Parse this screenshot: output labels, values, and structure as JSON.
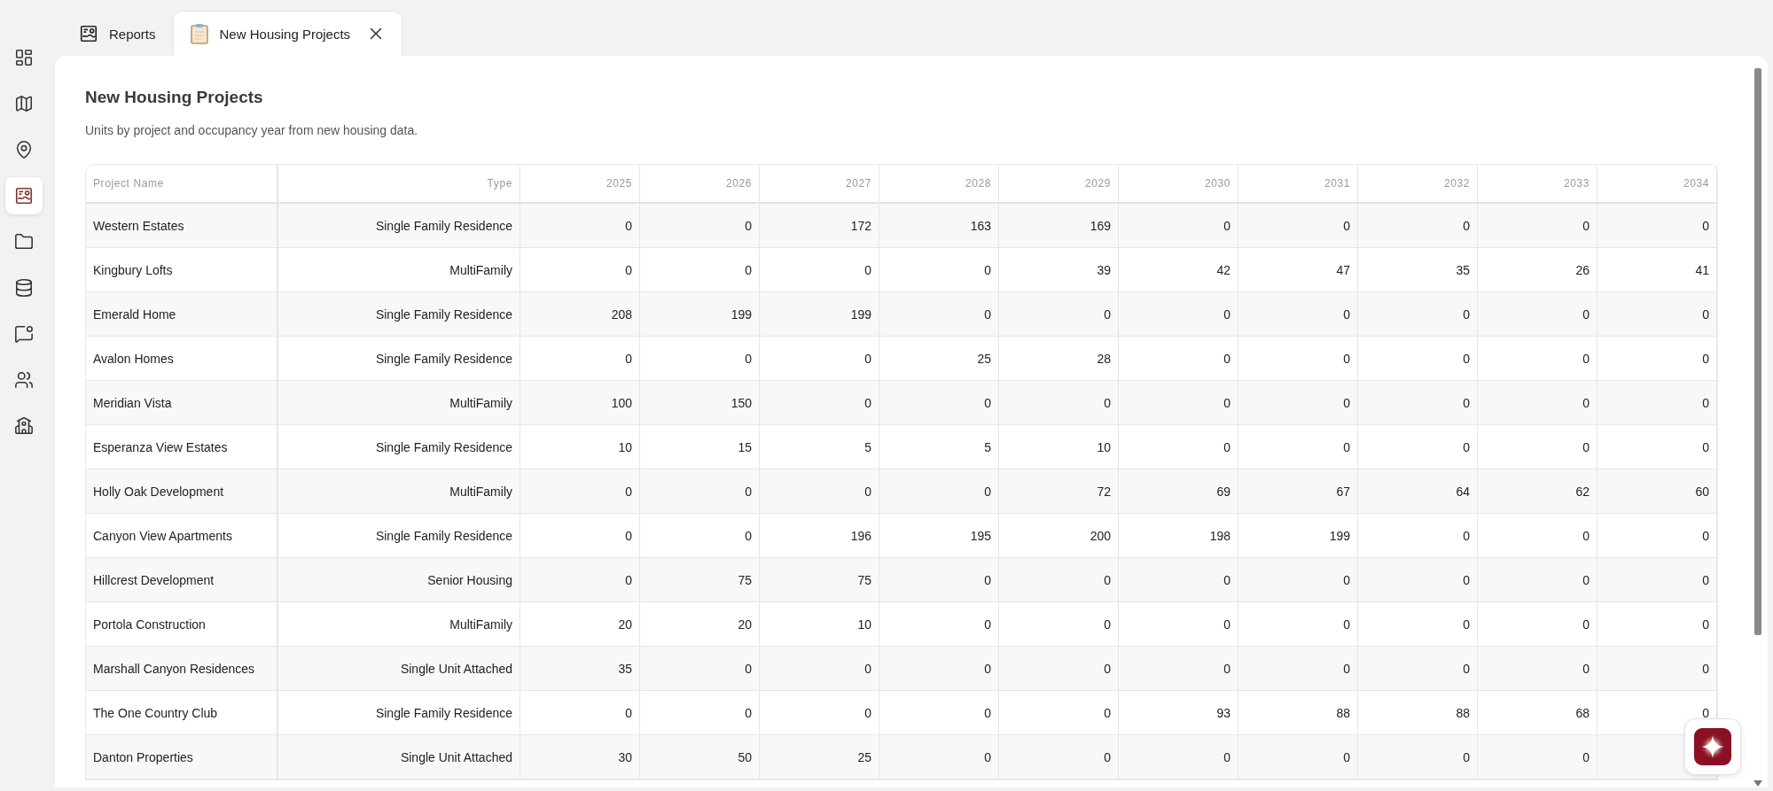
{
  "sidebar": {
    "items": [
      {
        "kind": "dashboard",
        "selected": false
      },
      {
        "kind": "map",
        "selected": false
      },
      {
        "kind": "pin",
        "selected": false
      },
      {
        "kind": "report",
        "selected": true
      },
      {
        "kind": "folder",
        "selected": false
      },
      {
        "kind": "database",
        "selected": false
      },
      {
        "kind": "chat",
        "selected": false
      },
      {
        "kind": "users",
        "selected": false
      },
      {
        "kind": "building",
        "selected": false
      }
    ]
  },
  "tabs": [
    {
      "label": "Reports",
      "kind": "report",
      "selected": false,
      "closable": false
    },
    {
      "label": "New Housing Projects",
      "kind": "clipboard",
      "selected": true,
      "closable": true
    }
  ],
  "report": {
    "title": "New Housing Projects",
    "subtitle": "Units by project and occupancy year from new housing data."
  },
  "table": {
    "columns": [
      "Project Name",
      "Type",
      "2025",
      "2026",
      "2027",
      "2028",
      "2029",
      "2030",
      "2031",
      "2032",
      "2033",
      "2034"
    ],
    "rows": [
      [
        "Western Estates",
        "Single Family Residence",
        "0",
        "0",
        "172",
        "163",
        "169",
        "0",
        "0",
        "0",
        "0",
        "0"
      ],
      [
        "Kingbury Lofts",
        "MultiFamily",
        "0",
        "0",
        "0",
        "0",
        "39",
        "42",
        "47",
        "35",
        "26",
        "41"
      ],
      [
        "Emerald Home",
        "Single Family Residence",
        "208",
        "199",
        "199",
        "0",
        "0",
        "0",
        "0",
        "0",
        "0",
        "0"
      ],
      [
        "Avalon Homes",
        "Single Family Residence",
        "0",
        "0",
        "0",
        "25",
        "28",
        "0",
        "0",
        "0",
        "0",
        "0"
      ],
      [
        "Meridian Vista",
        "MultiFamily",
        "100",
        "150",
        "0",
        "0",
        "0",
        "0",
        "0",
        "0",
        "0",
        "0"
      ],
      [
        "Esperanza View Estates",
        "Single Family Residence",
        "10",
        "15",
        "5",
        "5",
        "10",
        "0",
        "0",
        "0",
        "0",
        "0"
      ],
      [
        "Holly Oak Development",
        "MultiFamily",
        "0",
        "0",
        "0",
        "0",
        "72",
        "69",
        "67",
        "64",
        "62",
        "60"
      ],
      [
        "Canyon View Apartments",
        "Single Family Residence",
        "0",
        "0",
        "196",
        "195",
        "200",
        "198",
        "199",
        "0",
        "0",
        "0"
      ],
      [
        "Hillcrest Development",
        "Senior Housing",
        "0",
        "75",
        "75",
        "0",
        "0",
        "0",
        "0",
        "0",
        "0",
        "0"
      ],
      [
        "Portola Construction",
        "MultiFamily",
        "20",
        "20",
        "10",
        "0",
        "0",
        "0",
        "0",
        "0",
        "0",
        "0"
      ],
      [
        "Marshall Canyon Residences",
        "Single Unit Attached",
        "35",
        "0",
        "0",
        "0",
        "0",
        "0",
        "0",
        "0",
        "0",
        "0"
      ],
      [
        "The One Country Club",
        "Single Family Residence",
        "0",
        "0",
        "0",
        "0",
        "0",
        "93",
        "88",
        "88",
        "68",
        "0"
      ],
      [
        "Danton Properties",
        "Single Unit Attached",
        "30",
        "50",
        "25",
        "0",
        "0",
        "0",
        "0",
        "0",
        "0"
      ]
    ]
  }
}
